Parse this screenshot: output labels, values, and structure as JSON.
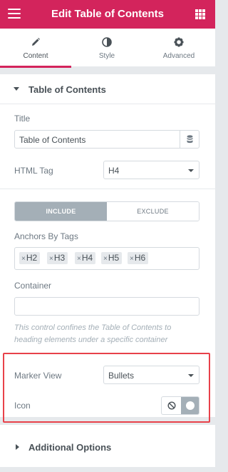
{
  "header": {
    "title": "Edit Table of Contents",
    "menu_icon": "hamburger-icon",
    "apps_icon": "grid-icon"
  },
  "tabs": [
    {
      "label": "Content",
      "icon": "pencil-icon",
      "active": true
    },
    {
      "label": "Style",
      "icon": "contrast-circle-icon",
      "active": false
    },
    {
      "label": "Advanced",
      "icon": "gear-icon",
      "active": false
    }
  ],
  "section": {
    "title": "Table of Contents"
  },
  "fields": {
    "title_label": "Title",
    "title_value": "Table of Contents",
    "html_tag_label": "HTML Tag",
    "html_tag_value": "H4",
    "include_label": "INCLUDE",
    "exclude_label": "EXCLUDE",
    "anchors_label": "Anchors By Tags",
    "anchor_tags": [
      "H2",
      "H3",
      "H4",
      "H5",
      "H6"
    ],
    "tag_remove_glyph": "×",
    "container_label": "Container",
    "container_value": "",
    "container_note": "This control confines the Table of Contents to heading elements under a specific container",
    "marker_view_label": "Marker View",
    "marker_view_value": "Bullets",
    "icon_label": "Icon"
  },
  "additional": {
    "title": "Additional Options"
  },
  "colors": {
    "brand": "#d3245c",
    "highlight": "#e8414a",
    "toggle_active": "#a4afb7"
  }
}
